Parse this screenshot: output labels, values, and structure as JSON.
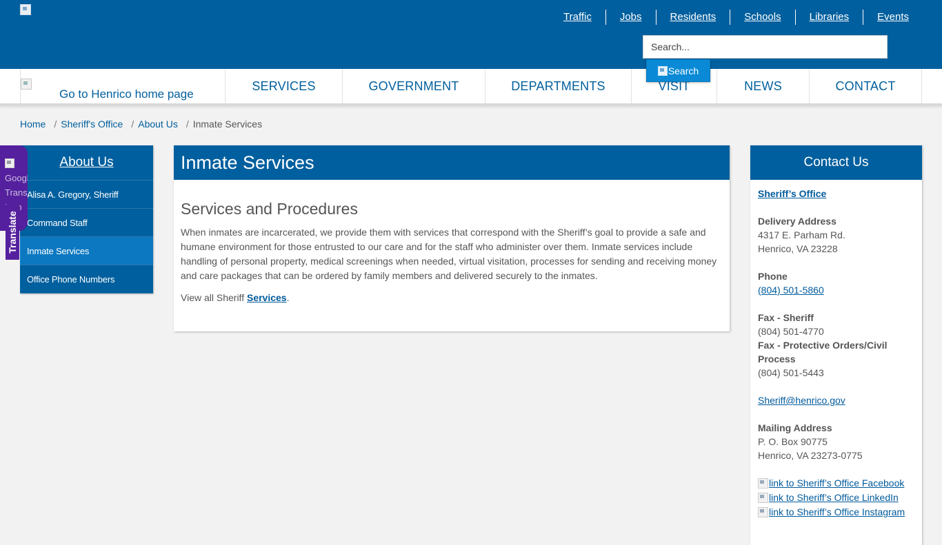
{
  "header": {
    "logo_icon": "county-logo-broken-image-icon",
    "utility_links": [
      "Traffic",
      "Jobs",
      "Residents",
      "Schools",
      "Libraries",
      "Events"
    ],
    "search_placeholder": "Search...",
    "search_button_label": "Search"
  },
  "nav": {
    "home_link_label": "Go to Henrico home page",
    "items": [
      "SERVICES",
      "GOVERNMENT",
      "DEPARTMENTS",
      "VISIT",
      "NEWS",
      "CONTACT"
    ]
  },
  "breadcrumb": {
    "items": [
      "Home",
      "Sheriff's Office",
      "About Us"
    ],
    "current": "Inmate Services"
  },
  "translate": {
    "icon_alt": "Google Translate Icon",
    "label": "Translate"
  },
  "sidebar": {
    "title": "About Us",
    "items": [
      "Alisa A. Gregory, Sheriff",
      "Command Staff",
      "Inmate Services",
      "Office Phone Numbers"
    ],
    "active_index": 2
  },
  "main": {
    "title": "Inmate Services",
    "subtitle": "Services and Procedures",
    "body": "When inmates are incarcerated, we provide them with services that correspond with the Sheriff’s goal to provide a safe and humane environment for those entrusted to our care and for the staff who administer over them. Inmate services include handling of personal property, medical screenings when needed, virtual visitation, processes for sending and receiving money and care packages that can be ordered by family members and delivered securely to the inmates.",
    "view_all_prefix": "View all Sheriff ",
    "view_all_link": "Services",
    "view_all_suffix": "."
  },
  "contact": {
    "title": "Contact Us",
    "org_link": "Sheriff’s Office",
    "delivery_label": "Delivery Address",
    "delivery_line1": "4317 E. Parham Rd.",
    "delivery_line2": "Henrico, VA 23228",
    "phone_label": "Phone",
    "phone": "(804) 501-5860",
    "fax_sheriff_label": "Fax - Sheriff",
    "fax_sheriff": "(804) 501-4770",
    "fax_civil_label": "Fax - Protective Orders/Civil Process",
    "fax_civil": "(804) 501-5443",
    "email": "Sheriff@henrico.gov",
    "mailing_label": "Mailing Address",
    "mailing_line1": "P. O. Box 90775",
    "mailing_line2": "Henrico, VA 23273-0775",
    "social": [
      "link to Sheriff’s Office Facebook",
      "link to Sheriff’s Office LinkedIn",
      "link to Sheriff’s Office Instagram"
    ]
  },
  "colors": {
    "brand_blue": "#005f9e",
    "active_blue": "#0b78c1",
    "translate_purple": "#55209e"
  }
}
